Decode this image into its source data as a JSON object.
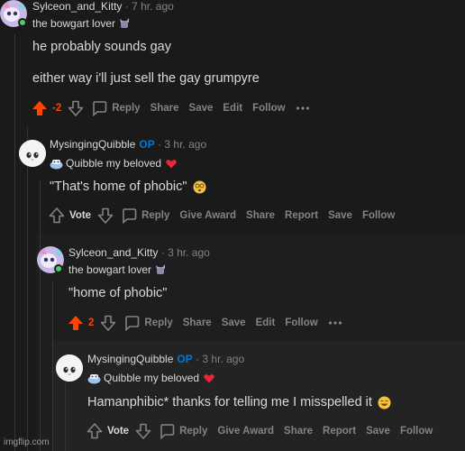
{
  "comments": [
    {
      "username": "Sylceon_and_Kitty",
      "time": "7 hr. ago",
      "flair": "the bowgart lover",
      "lines": [
        "he probably sounds gay",
        "either way i'll just sell the gay grumpyre"
      ],
      "vote": "-2",
      "actions": [
        "Reply",
        "Share",
        "Save",
        "Edit",
        "Follow"
      ]
    },
    {
      "username": "MysingingQuibble",
      "op": "OP",
      "time": "3 hr. ago",
      "flair": "Quibble my beloved",
      "lines": [
        "\"That's home of phobic\""
      ],
      "vote": "Vote",
      "actions": [
        "Reply",
        "Give Award",
        "Share",
        "Report",
        "Save",
        "Follow"
      ]
    },
    {
      "username": "Sylceon_and_Kitty",
      "time": "3 hr. ago",
      "flair": "the bowgart lover",
      "lines": [
        "\"home of phobic\""
      ],
      "vote": "2",
      "actions": [
        "Reply",
        "Share",
        "Save",
        "Edit",
        "Follow"
      ]
    },
    {
      "username": "MysingingQuibble",
      "op": "OP",
      "time": "3 hr. ago",
      "flair": "Quibble my beloved",
      "lines": [
        "Hamanphibic* thanks for telling me I misspelled it"
      ],
      "vote": "Vote",
      "actions": [
        "Reply",
        "Give Award",
        "Share",
        "Report",
        "Save",
        "Follow"
      ]
    }
  ],
  "more_icon": "ellipsis-icon",
  "watermark": "imgflip.com",
  "colors": {
    "background": "#1a1a1b",
    "upvote": "#ff4500",
    "op": "#0079d3",
    "muted": "#818384"
  }
}
